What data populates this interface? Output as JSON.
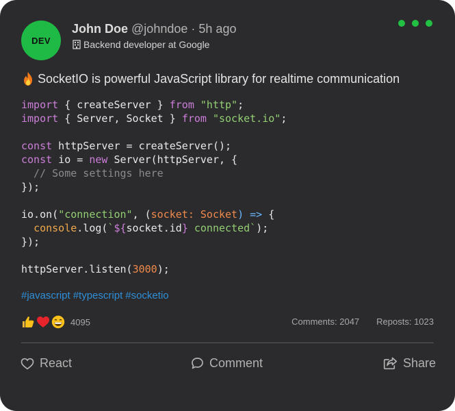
{
  "author": {
    "avatar_text": "DEV",
    "name": "John Doe",
    "handle": "@johndoe",
    "separator": "·",
    "time": "5h ago",
    "headline": "Backend developer at Google"
  },
  "post": {
    "text": "SocketIO is powerful JavaScript library for realtime communication",
    "code": {
      "l1": {
        "a": "import",
        "b": " { createServer } ",
        "c": "from",
        "d": " ",
        "e": "\"http\"",
        "f": ";"
      },
      "l2": {
        "a": "import",
        "b": " { Server, Socket } ",
        "c": "from",
        "d": " ",
        "e": "\"socket.io\"",
        "f": ";"
      },
      "l4": {
        "a": "const",
        "b": " httpServer = createServer();"
      },
      "l5": {
        "a": "const",
        "b": " io = ",
        "c": "new",
        "d": " Server(httpServer, {"
      },
      "l6": {
        "a": "  // Some settings here"
      },
      "l7": {
        "a": "});"
      },
      "l9": {
        "a": "io.on(",
        "b": "\"connection\"",
        "c": ", (",
        "d": "socket",
        "e": ": ",
        "f": "Socket",
        "g": ") ",
        "h": "=>",
        "i": " {"
      },
      "l10": {
        "a": "  ",
        "b": "console",
        "c": ".log(",
        "d": "`",
        "e": "${",
        "f": "socket.id",
        "g": "}",
        "h": " connected",
        "i": "`",
        "j": ");"
      },
      "l11": {
        "a": "});"
      },
      "l13": {
        "a": "httpServer.listen(",
        "b": "3000",
        "c": ");"
      }
    },
    "hashtags": [
      "#javascript",
      "#typescript",
      "#socketio"
    ]
  },
  "reactions": {
    "emojis": [
      "thumbs-up",
      "heart",
      "grinning-face"
    ],
    "count": "4095"
  },
  "stats": {
    "comments": "Comments: 2047",
    "reposts": "Reposts: 1023"
  },
  "actions": {
    "react": "React",
    "comment": "Comment",
    "share": "Share"
  },
  "colors": {
    "card_bg": "#2b2b2d",
    "accent_green": "#22c043",
    "hashtag_blue": "#2e8fd8"
  }
}
